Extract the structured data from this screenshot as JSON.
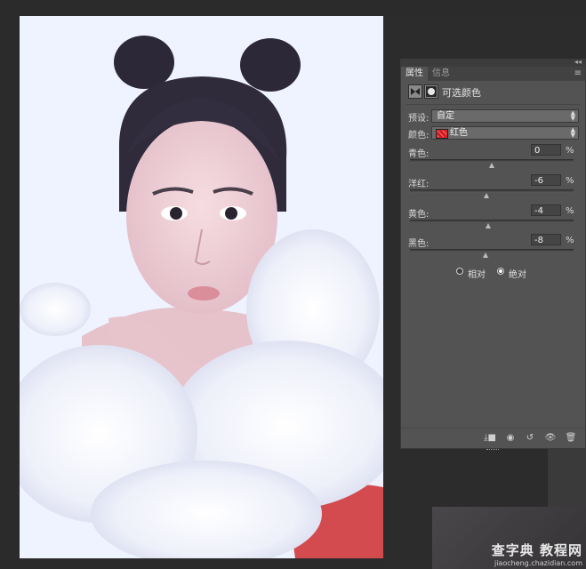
{
  "panel": {
    "tabs": [
      "属性",
      "信息"
    ],
    "title": "可选颜色",
    "preset_label": "预设:",
    "preset_value": "自定",
    "colors_label": "颜色:",
    "colors_value": "红色",
    "swatch_color": "#e0262f",
    "sliders": [
      {
        "label": "青色:",
        "value": "0",
        "unit": "%",
        "percent": 0
      },
      {
        "label": "洋红:",
        "value": "-6",
        "unit": "%",
        "percent": -6
      },
      {
        "label": "黄色:",
        "value": "-4",
        "unit": "%",
        "percent": -4
      },
      {
        "label": "黑色:",
        "value": "-8",
        "unit": "%",
        "percent": -8
      }
    ],
    "method": {
      "options": [
        "相对",
        "绝对"
      ],
      "selected": "绝对"
    }
  },
  "watermark": {
    "main": "查字典 教程网",
    "url": "jiaocheng.chazidian.com"
  }
}
